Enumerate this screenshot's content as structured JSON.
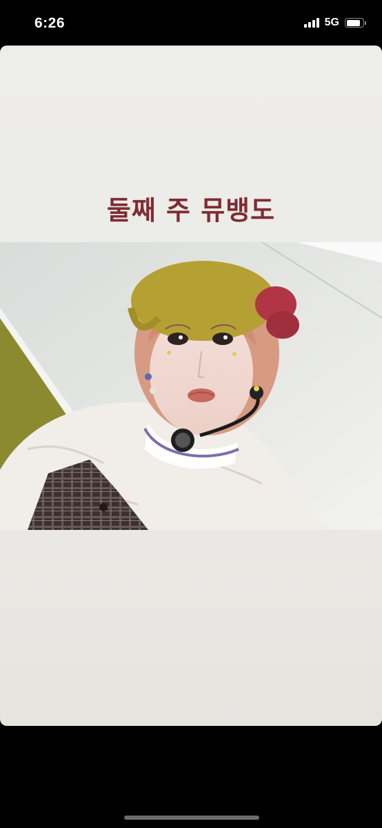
{
  "status_bar": {
    "time": "6:26",
    "network": "5G",
    "signal_bars": 4,
    "battery_level": 0.85,
    "icons": [
      "signal-icon",
      "battery-icon"
    ]
  },
  "story": {
    "caption": "둘째 주 뮤뱅도",
    "caption_color": "#7f2c34",
    "background_color": "#ecebe7",
    "photo": {
      "description_icon": "selfie-photo"
    }
  }
}
